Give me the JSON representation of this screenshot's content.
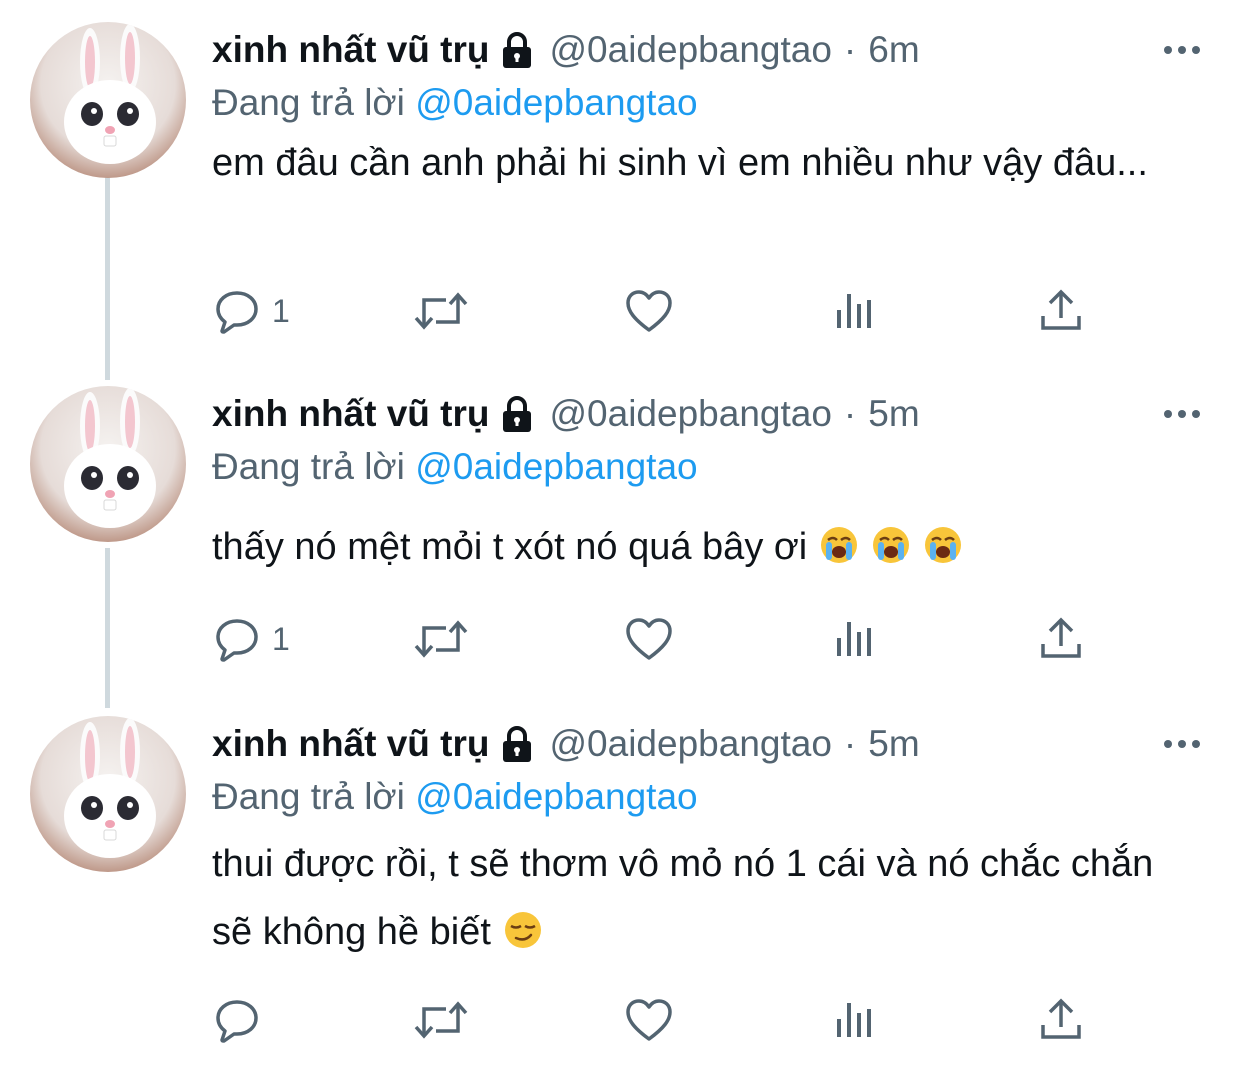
{
  "tweets": [
    {
      "display_name": "xinh nhất vũ trụ",
      "handle": "@0aidepbangtao",
      "separator": "·",
      "time": "6m",
      "reply_prefix": "Đang trả lời",
      "reply_to": "@0aidepbangtao",
      "text": "em đâu cần anh phải hi sinh vì em nhiều như vậy đâu...",
      "emojis": [],
      "reply_count": "1"
    },
    {
      "display_name": "xinh nhất vũ trụ",
      "handle": "@0aidepbangtao",
      "separator": "·",
      "time": "5m",
      "reply_prefix": "Đang trả lời",
      "reply_to": "@0aidepbangtao",
      "text": "thấy nó mệt mỏi t xót nó quá bây ơi",
      "emojis": [
        "loudly-crying-face",
        "loudly-crying-face",
        "loudly-crying-face"
      ],
      "reply_count": "1"
    },
    {
      "display_name": "xinh nhất vũ trụ",
      "handle": "@0aidepbangtao",
      "separator": "·",
      "time": "5m",
      "reply_prefix": "Đang trả lời",
      "reply_to": "@0aidepbangtao",
      "text": "thui được rồi, t sẽ thơm vô mỏ nó 1 cái và nó chắc chắn sẽ không hề biết",
      "emojis": [
        "smirking-face"
      ],
      "reply_count": ""
    }
  ],
  "icons": {
    "lock": "lock-icon",
    "more": "more-icon",
    "reply": "reply-icon",
    "retweet": "retweet-icon",
    "like": "like-icon",
    "views": "views-icon",
    "share": "share-icon"
  },
  "colors": {
    "text": "#0f1419",
    "secondary": "#536471",
    "link": "#1d9bf0",
    "thread_line": "#cfd9de"
  }
}
